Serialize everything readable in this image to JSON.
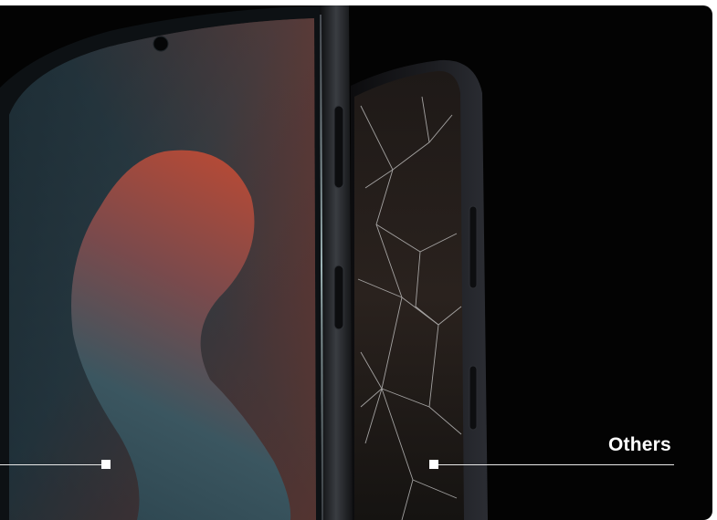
{
  "comparison": {
    "left_label": "",
    "right_label": "Others"
  },
  "colors": {
    "background": "#030303",
    "frame": "#1a1c20",
    "screen_teal": "#233a42",
    "screen_red": "#a8402f",
    "label_text": "#ffffff"
  },
  "icons": {
    "marker_left": "square-marker-icon",
    "marker_right": "square-marker-icon"
  }
}
